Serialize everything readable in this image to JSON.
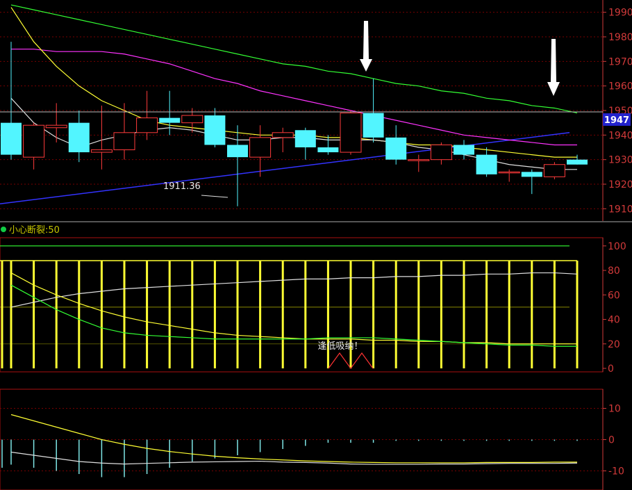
{
  "main_panel": {
    "price_axis_ticks": [
      "1990",
      "1980",
      "1970",
      "1960",
      "1950",
      "1940",
      "1930",
      "1920",
      "1910"
    ],
    "current_price_label": "1947",
    "low_annotation": "1911.36"
  },
  "indicator_panel": {
    "label": "小心断裂:50",
    "axis_ticks": [
      "100",
      "80",
      "60",
      "40",
      "20",
      "0"
    ],
    "signal_text": "逢低吸纳！"
  },
  "macd_panel": {
    "axis_ticks": [
      "10",
      "0",
      "-10"
    ]
  },
  "colors": {
    "up_candle": "#ff3b3b",
    "down_candle": "#52f5ff",
    "ma_white": "#e0e0e0",
    "ma_yellow": "#ffff33",
    "ma_magenta": "#ff33ff",
    "ma_green": "#33ff33",
    "trend_blue": "#3333ff",
    "axis_red": "#d23a3a",
    "grid_red": "#7a0000"
  },
  "chart_data": {
    "type": "candlestick",
    "y_range": [
      1905,
      1995
    ],
    "candles": [
      {
        "o": 1945,
        "h": 1978,
        "l": 1930,
        "c": 1932
      },
      {
        "o": 1931,
        "h": 1945,
        "l": 1926,
        "c": 1944
      },
      {
        "o": 1943,
        "h": 1953,
        "l": 1937,
        "c": 1944
      },
      {
        "o": 1945,
        "h": 1950,
        "l": 1929,
        "c": 1933
      },
      {
        "o": 1933,
        "h": 1952,
        "l": 1926,
        "c": 1934
      },
      {
        "o": 1934,
        "h": 1953,
        "l": 1930,
        "c": 1941
      },
      {
        "o": 1941,
        "h": 1958,
        "l": 1938,
        "c": 1947
      },
      {
        "o": 1947,
        "h": 1958,
        "l": 1940,
        "c": 1945
      },
      {
        "o": 1945,
        "h": 1951,
        "l": 1941,
        "c": 1948
      },
      {
        "o": 1948,
        "h": 1951,
        "l": 1935,
        "c": 1936
      },
      {
        "o": 1936,
        "h": 1944,
        "l": 1911,
        "c": 1931
      },
      {
        "o": 1931,
        "h": 1944,
        "l": 1923,
        "c": 1939
      },
      {
        "o": 1939,
        "h": 1943,
        "l": 1933,
        "c": 1941
      },
      {
        "o": 1942,
        "h": 1943,
        "l": 1930,
        "c": 1935
      },
      {
        "o": 1935,
        "h": 1940,
        "l": 1932,
        "c": 1933
      },
      {
        "o": 1933,
        "h": 1950,
        "l": 1932,
        "c": 1949
      },
      {
        "o": 1949,
        "h": 1963,
        "l": 1937,
        "c": 1939
      },
      {
        "o": 1939,
        "h": 1944,
        "l": 1928,
        "c": 1930
      },
      {
        "o": 1930,
        "h": 1932,
        "l": 1925,
        "c": 1930
      },
      {
        "o": 1930,
        "h": 1937,
        "l": 1928,
        "c": 1936
      },
      {
        "o": 1936,
        "h": 1938,
        "l": 1930,
        "c": 1932
      },
      {
        "o": 1932,
        "h": 1935,
        "l": 1923,
        "c": 1924
      },
      {
        "o": 1925,
        "h": 1926,
        "l": 1921,
        "c": 1925
      },
      {
        "o": 1925,
        "h": 1926,
        "l": 1916,
        "c": 1923
      },
      {
        "o": 1923,
        "h": 1929,
        "l": 1922,
        "c": 1928
      },
      {
        "o": 1930,
        "h": 1932,
        "l": 1928,
        "c": 1928
      }
    ],
    "ma_white": [
      1955,
      1945,
      1939,
      1935,
      1938,
      1940,
      1942,
      1943,
      1942,
      1940,
      1938,
      1938,
      1939,
      1939,
      1938,
      1938,
      1938,
      1937,
      1935,
      1934,
      1932,
      1930,
      1928,
      1927,
      1926,
      1926
    ],
    "ma_yellow": [
      1992,
      1978,
      1968,
      1960,
      1954,
      1950,
      1946,
      1944,
      1943,
      1942,
      1941,
      1940,
      1940,
      1940,
      1939,
      1939,
      1938,
      1937,
      1936,
      1936,
      1935,
      1934,
      1933,
      1932,
      1931,
      1931
    ],
    "ma_magenta": [
      1975,
      1975,
      1974,
      1974,
      1974,
      1973,
      1971,
      1969,
      1966,
      1963,
      1961,
      1958,
      1956,
      1954,
      1952,
      1950,
      1948,
      1946,
      1944,
      1942,
      1940,
      1939,
      1938,
      1937,
      1936,
      1936
    ],
    "ma_green": [
      1993,
      1991,
      1989,
      1987,
      1985,
      1983,
      1981,
      1979,
      1977,
      1975,
      1973,
      1971,
      1969,
      1968,
      1966,
      1965,
      1963,
      1961,
      1960,
      1958,
      1957,
      1955,
      1954,
      1952,
      1951,
      1949
    ],
    "trend_blue": [
      1912,
      1941
    ],
    "indicator": {
      "y_range": [
        0,
        105
      ],
      "bars": [
        88,
        88,
        88,
        88,
        88,
        88,
        88,
        88,
        88,
        88,
        88,
        88,
        88,
        88,
        88,
        88,
        88,
        88,
        88,
        88,
        88,
        88,
        88,
        88,
        88,
        88
      ],
      "line_white": [
        50,
        54,
        58,
        61,
        63,
        65,
        66,
        67,
        68,
        69,
        70,
        71,
        72,
        73,
        73,
        74,
        74,
        75,
        75,
        76,
        76,
        77,
        77,
        78,
        78,
        77
      ],
      "line_yellow": [
        78,
        68,
        60,
        53,
        47,
        42,
        38,
        35,
        32,
        29,
        27,
        26,
        25,
        24,
        24,
        24,
        23,
        23,
        22,
        22,
        21,
        21,
        20,
        20,
        20,
        20
      ],
      "line_green": [
        68,
        58,
        48,
        40,
        33,
        29,
        27,
        26,
        25,
        24,
        24,
        24,
        24,
        24,
        25,
        25,
        25,
        24,
        23,
        22,
        21,
        20,
        19,
        19,
        18,
        18
      ],
      "signal_x": 15
    },
    "macd": {
      "y_range": [
        -15,
        15
      ],
      "histogram": [
        -8,
        -9,
        -10,
        -11,
        -12,
        -12,
        -11,
        -9,
        -7,
        -6,
        -5,
        -4,
        -3,
        -2,
        -1,
        -1,
        -1,
        0,
        0,
        0,
        0,
        0,
        0,
        0,
        0,
        0
      ],
      "dif": [
        -4,
        -5,
        -6,
        -7,
        -7.5,
        -7.8,
        -7.6,
        -7.4,
        -7.2,
        -7.1,
        -7.0,
        -6.9,
        -7.2,
        -7.3,
        -7.5,
        -7.8,
        -7.9,
        -7.9,
        -7.9,
        -7.8,
        -7.8,
        -7.7,
        -7.6,
        -7.6,
        -7.6,
        -7.5
      ],
      "dea": [
        8,
        6,
        4,
        2,
        0,
        -1.5,
        -2.8,
        -3.8,
        -4.6,
        -5.3,
        -5.8,
        -6.2,
        -6.5,
        -6.8,
        -7.0,
        -7.2,
        -7.3,
        -7.4,
        -7.4,
        -7.4,
        -7.4,
        -7.3,
        -7.3,
        -7.3,
        -7.2,
        -7.2
      ]
    }
  }
}
